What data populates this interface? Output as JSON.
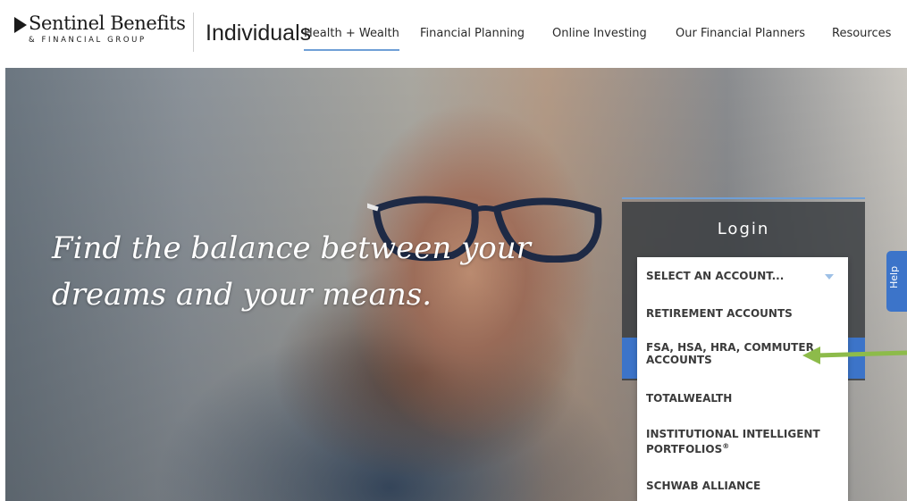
{
  "brand": {
    "name": "Sentinel Benefits",
    "subname": "& FINANCIAL GROUP",
    "section": "Individuals"
  },
  "nav": {
    "items": [
      {
        "label": "Health + Wealth",
        "active": true
      },
      {
        "label": "Financial Planning"
      },
      {
        "label": "Online Investing"
      },
      {
        "label": "Our Financial Planners"
      },
      {
        "label": "Resources"
      }
    ]
  },
  "hero": {
    "headline": "Find the balance between your dreams and your means."
  },
  "login": {
    "title": "Login",
    "select": {
      "placeholder": "SELECT AN ACCOUNT...",
      "options": [
        {
          "label": "RETIREMENT ACCOUNTS"
        },
        {
          "label": "FSA, HSA, HRA, COMMUTER ACCOUNTS"
        },
        {
          "label": "TOTALWEALTH"
        },
        {
          "label": "INSTITUTIONAL INTELLIGENT PORTFOLIOS",
          "suffix": "®"
        },
        {
          "label": "SCHWAB ALLIANCE"
        }
      ]
    }
  },
  "help": {
    "label": "Help"
  },
  "colors": {
    "accent_blue": "#3c74c9",
    "nav_underline": "#6f9fd6",
    "arrow_green": "#8dbb4a"
  }
}
